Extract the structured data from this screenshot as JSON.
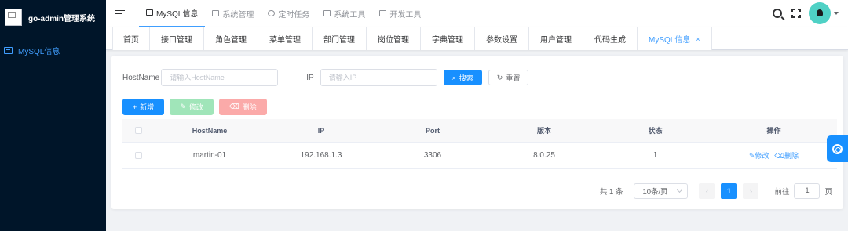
{
  "sidebar": {
    "brand_title": "go-admin管理系统",
    "items": [
      {
        "label": "MySQL信息",
        "icon": "database-icon",
        "active": true
      }
    ]
  },
  "topnav": {
    "items": [
      {
        "label": "MySQL信息",
        "active": true
      },
      {
        "label": "系统管理"
      },
      {
        "label": "定时任务"
      },
      {
        "label": "系统工具"
      },
      {
        "label": "开发工具"
      }
    ]
  },
  "tags": {
    "items": [
      {
        "label": "首页"
      },
      {
        "label": "接口管理"
      },
      {
        "label": "角色管理"
      },
      {
        "label": "菜单管理"
      },
      {
        "label": "部门管理"
      },
      {
        "label": "岗位管理"
      },
      {
        "label": "字典管理"
      },
      {
        "label": "参数设置"
      },
      {
        "label": "用户管理"
      },
      {
        "label": "代码生成"
      },
      {
        "label": "MySQL信息",
        "active": true,
        "close": "×"
      }
    ]
  },
  "filter": {
    "hostname_label": "HostName",
    "hostname_placeholder": "请输入HostName",
    "ip_label": "IP",
    "ip_placeholder": "请输入IP",
    "search_label": "搜索",
    "reset_label": "重置"
  },
  "actions": {
    "add_label": "新增",
    "edit_label": "修改",
    "delete_label": "删除"
  },
  "table": {
    "columns": [
      "HostName",
      "IP",
      "Port",
      "版本",
      "状态",
      "操作"
    ],
    "rows": [
      {
        "hostname": "martin-01",
        "ip": "192.168.1.3",
        "port": "3306",
        "version": "8.0.25",
        "status": "1",
        "edit": "修改",
        "delete": "删除"
      }
    ]
  },
  "pagination": {
    "total": "共 1 条",
    "page_size": "10条/页",
    "current_page": "1",
    "goto_label": "前往",
    "goto_value": "1",
    "page_unit": "页"
  },
  "colors": {
    "primary": "#1890ff",
    "sidebar_bg": "#001529",
    "success_disabled": "#a0e5b9",
    "danger_disabled": "#fbaaa9"
  }
}
